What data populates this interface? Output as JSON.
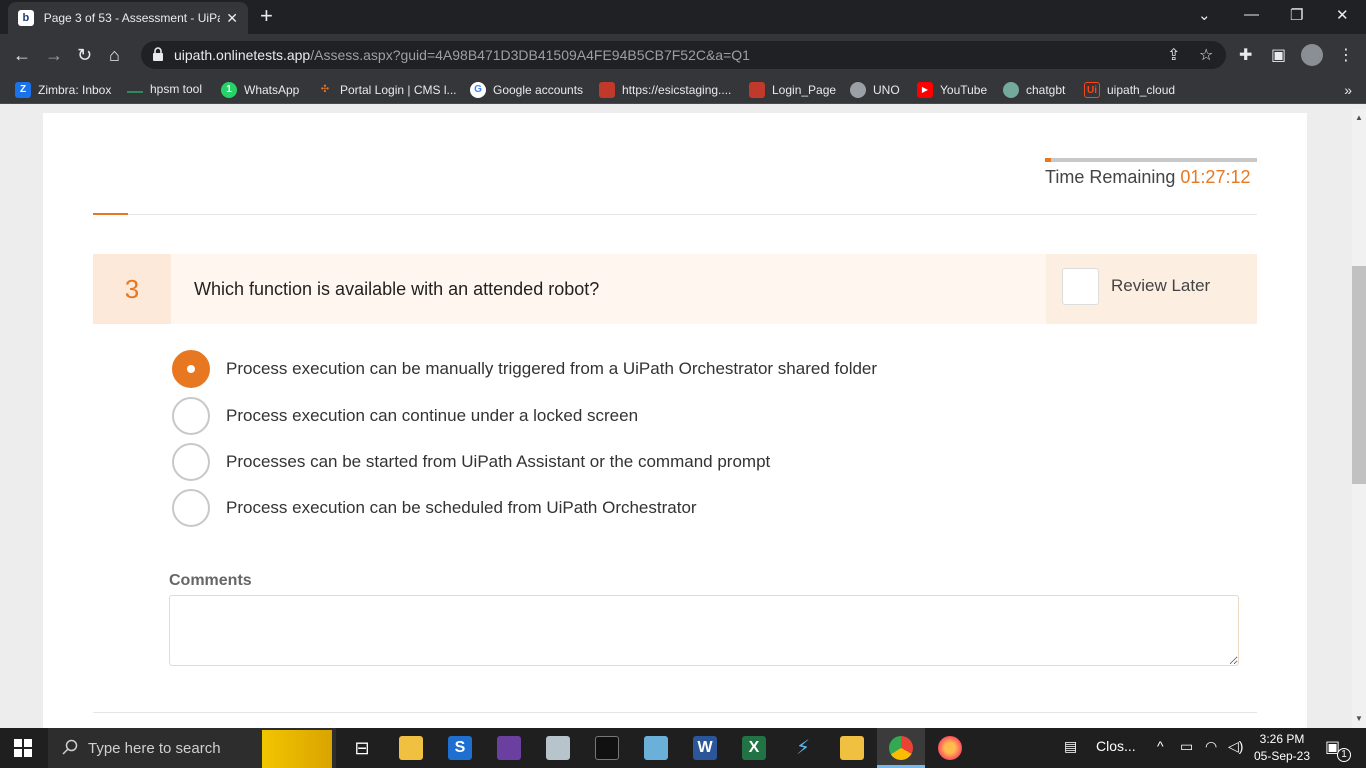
{
  "browser": {
    "tab_title": "Page 3 of 53 - Assessment - UiPath",
    "url_host": "uipath.onlinetests.app",
    "url_path": "/Assess.aspx?guid=4A98B471D3DB41509A4FE94B5CB7F52C&a=Q1"
  },
  "bookmarks": [
    {
      "label": "Zimbra: Inbox",
      "color": "#1a73e8",
      "glyph": "Z"
    },
    {
      "label": "hpsm tool",
      "color": "#2e8b57",
      "glyph": ""
    },
    {
      "label": "WhatsApp",
      "color": "#25d366",
      "glyph": "1"
    },
    {
      "label": "Portal Login | CMS l...",
      "color": "#e87722",
      "glyph": "✣"
    },
    {
      "label": "Google accounts",
      "color": "#ffffff",
      "glyph": "G"
    },
    {
      "label": "https://esicstaging....",
      "color": "#c0392b",
      "glyph": ""
    },
    {
      "label": "Login_Page",
      "color": "#c0392b",
      "glyph": ""
    },
    {
      "label": "UNO",
      "color": "#9aa0a6",
      "glyph": ""
    },
    {
      "label": "YouTube",
      "color": "#ff0000",
      "glyph": "▶"
    },
    {
      "label": "chatgbt",
      "color": "#74aa9c",
      "glyph": ""
    },
    {
      "label": "uipath_cloud",
      "color": "#fa4616",
      "glyph": "Ui"
    }
  ],
  "timer": {
    "label": "Time Remaining",
    "value": "01:27:12",
    "progress_fraction": 0.03
  },
  "question": {
    "number": "3",
    "text": "Which function is available with an attended robot?",
    "review_label": "Review Later",
    "review_checked": false
  },
  "options": [
    {
      "label": "Process execution can be manually triggered from a UiPath Orchestrator shared folder",
      "selected": true
    },
    {
      "label": "Process execution can continue under a locked screen",
      "selected": false
    },
    {
      "label": "Processes can be started from UiPath Assistant or the command prompt",
      "selected": false
    },
    {
      "label": "Process execution can be scheduled from UiPath Orchestrator",
      "selected": false
    }
  ],
  "comments": {
    "label": "Comments",
    "value": ""
  },
  "taskbar": {
    "search_placeholder": "Type here to search",
    "tray_app_label": "Clos...",
    "time": "3:26 PM",
    "date": "05-Sep-23",
    "notification_count": "1"
  },
  "colors": {
    "accent": "#e87722",
    "chrome_dark": "#202124",
    "chrome_toolbar": "#35363a"
  }
}
